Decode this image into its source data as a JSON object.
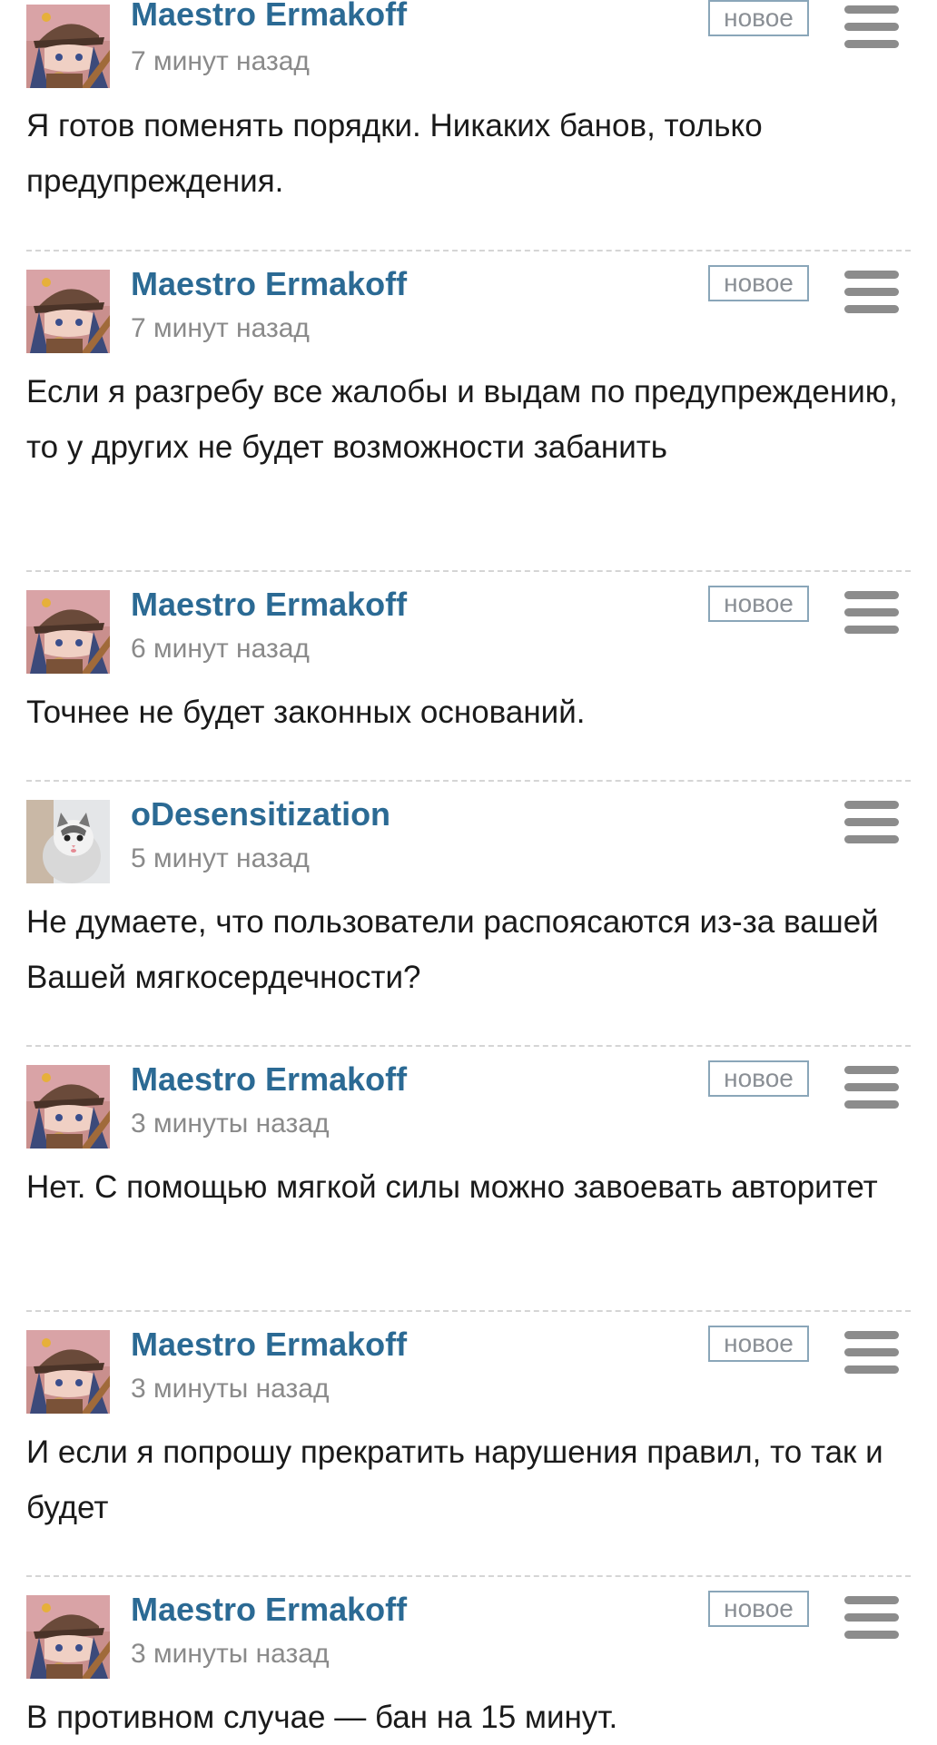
{
  "comments": [
    {
      "author": "Maestro Ermakoff",
      "time": "7 минут назад",
      "badge": "новое",
      "text": "Я готов поменять порядки. Никаких банов, только предупреждения.",
      "avatar": "anime-avatar",
      "menu_icon": "hamburger-menu-icon"
    },
    {
      "author": "Maestro Ermakoff",
      "time": "7 минут назад",
      "badge": "новое",
      "text": "Если я разгребу все жалобы и выдам по предупреждению, то у других не будет возможности забанить",
      "avatar": "anime-avatar",
      "menu_icon": "hamburger-menu-icon"
    },
    {
      "author": "Maestro Ermakoff",
      "time": "6 минут назад",
      "badge": "новое",
      "text": "Точнее не будет законных оснований.",
      "avatar": "anime-avatar",
      "menu_icon": "hamburger-menu-icon"
    },
    {
      "author": "oDesensitization",
      "time": "5 минут назад",
      "badge": "",
      "text": "Не думаете, что пользователи распоясаются из-за вашей Вашей мягкосердечности?",
      "avatar": "kitten-avatar",
      "menu_icon": "hamburger-menu-icon"
    },
    {
      "author": "Maestro Ermakoff",
      "time": "3 минуты назад",
      "badge": "новое",
      "text": "Нет. С помощью мягкой силы можно завоевать авторитет",
      "avatar": "anime-avatar",
      "menu_icon": "hamburger-menu-icon"
    },
    {
      "author": "Maestro Ermakoff",
      "time": "3 минуты назад",
      "badge": "новое",
      "text": "И если я попрошу прекратить нарушения правил, то так и будет",
      "avatar": "anime-avatar",
      "menu_icon": "hamburger-menu-icon"
    },
    {
      "author": "Maestro Ermakoff",
      "time": "3 минуты назад",
      "badge": "новое",
      "text": "В противном случае — бан на 15 минут.",
      "avatar": "anime-avatar",
      "menu_icon": "hamburger-menu-icon"
    }
  ],
  "colors": {
    "author": "#2b6a94",
    "time": "#8a8a8a",
    "badge_border": "#8aa6b9",
    "menu_icon": "#8c8c8c",
    "divider": "#d5d5d5",
    "text": "#1a1a1a"
  }
}
